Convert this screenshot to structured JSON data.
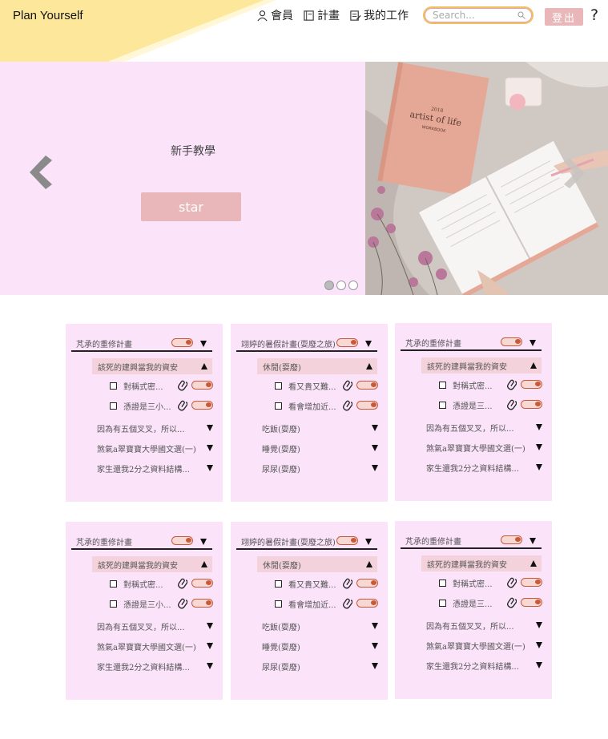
{
  "header": {
    "brand": "Plan Yourself",
    "nav": [
      {
        "label": "會員",
        "icon": "user-icon"
      },
      {
        "label": "計畫",
        "icon": "notebook-icon"
      },
      {
        "label": "我的工作",
        "icon": "tasks-icon"
      }
    ],
    "search_placeholder": "Search...",
    "logout_label": "登出",
    "help_label": "?"
  },
  "hero": {
    "title": "新手教學",
    "button_label": "star",
    "photo_text": {
      "year": "2018",
      "title": "artist of life",
      "subtitle": "WORKBOOK"
    },
    "slide_count": 3,
    "active_slide": 1
  },
  "colors": {
    "accent_pink": "#e9b7b9",
    "panel_bg": "#fbe3fa",
    "toggle": "#c85a3a",
    "banner_yellow": "#fde79a"
  },
  "cards": [
    {
      "title": "芃承的重修計畫",
      "section": "該死的建興當我的資安",
      "tasks": [
        "對稱式密...",
        "憑證是三小..."
      ],
      "items": [
        "因為有五個叉叉，所以...",
        "煞氣a翠寶寶大學國文選(一)",
        "家生還我2分之資料結構..."
      ]
    },
    {
      "title": "翊婷的暑假計畫(耍廢之旅)",
      "section": "休閒(耍廢)",
      "tasks": [
        "看又貴又難...",
        "看會增加近..."
      ],
      "items": [
        "吃飯(耍廢)",
        "睡覺(耍廢)",
        "尿尿(耍廢)"
      ]
    },
    {
      "title": "芃承的重修計畫",
      "section": "該死的建興當我的資安",
      "tasks": [
        "對稱式密...",
        "憑證是三..."
      ],
      "items": [
        "因為有五個叉叉，所以...",
        "煞氣a翠寶寶大學國文選(一)",
        "家生還我2分之資料結構..."
      ]
    },
    {
      "title": "芃承的重修計畫",
      "section": "該死的建興當我的資安",
      "tasks": [
        "對稱式密...",
        "憑證是三小..."
      ],
      "items": [
        "因為有五個叉叉，所以...",
        "煞氣a翠寶寶大學國文選(一)",
        "家生還我2分之資料結構..."
      ]
    },
    {
      "title": "翊婷的暑假計畫(耍廢之旅)",
      "section": "休閒(耍廢)",
      "tasks": [
        "看又貴又難...",
        "看會增加近..."
      ],
      "items": [
        "吃飯(耍廢)",
        "睡覺(耍廢)",
        "尿尿(耍廢)"
      ]
    },
    {
      "title": "芃承的重修計畫",
      "section": "該死的建興當我的資安",
      "tasks": [
        "對稱式密...",
        "憑證是三..."
      ],
      "items": [
        "因為有五個叉叉，所以...",
        "煞氣a翠寶寶大學國文選(一)",
        "家生還我2分之資料結構..."
      ]
    }
  ]
}
